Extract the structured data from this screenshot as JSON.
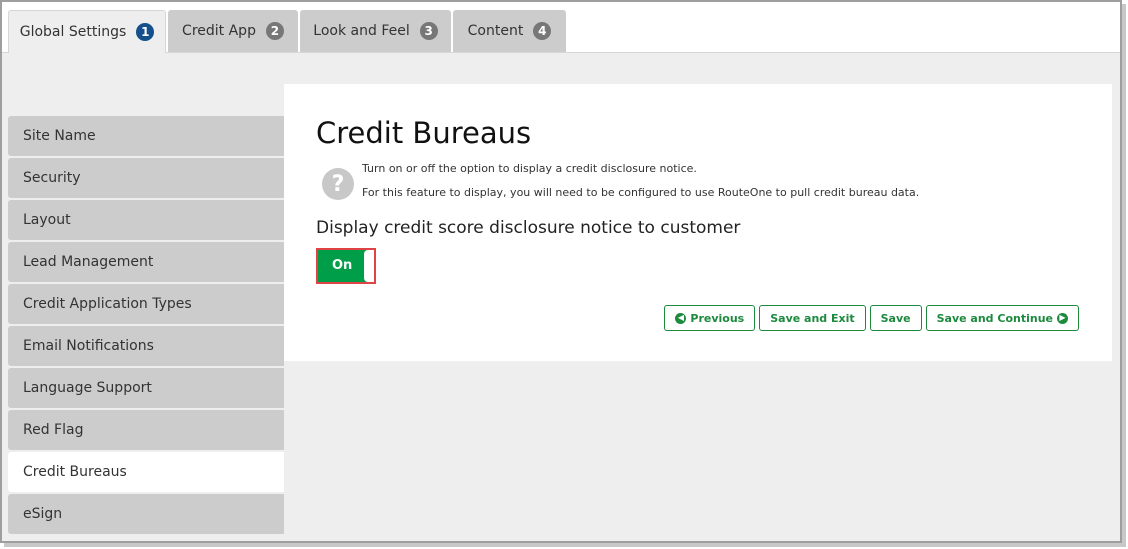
{
  "tabs": [
    {
      "label": "Global Settings",
      "badge": "1",
      "active": true
    },
    {
      "label": "Credit App",
      "badge": "2",
      "active": false
    },
    {
      "label": "Look and Feel",
      "badge": "3",
      "active": false
    },
    {
      "label": "Content",
      "badge": "4",
      "active": false
    }
  ],
  "sidebar": {
    "items": [
      {
        "label": "Site Name"
      },
      {
        "label": "Security"
      },
      {
        "label": "Layout"
      },
      {
        "label": "Lead Management"
      },
      {
        "label": "Credit Application Types"
      },
      {
        "label": "Email Notifications"
      },
      {
        "label": "Language Support"
      },
      {
        "label": "Red Flag"
      },
      {
        "label": "Credit Bureaus",
        "active": true
      },
      {
        "label": "eSign"
      }
    ]
  },
  "main": {
    "title": "Credit Bureaus",
    "help_icon": "question-circle-icon",
    "help_lines": [
      "Turn on or off the option to display a credit disclosure notice.",
      "For this feature to display, you will need to be configured to use RouteOne to pull credit bureau data."
    ],
    "setting_label": "Display credit score disclosure notice to customer",
    "toggle": {
      "label": "On",
      "state": "on"
    },
    "buttons": {
      "previous": "Previous",
      "save_exit": "Save and Exit",
      "save": "Save",
      "save_continue": "Save and Continue"
    }
  },
  "colors": {
    "accent_green": "#1d8a3d",
    "toggle_green": "#009e49",
    "toggle_highlight": "#e04343",
    "active_badge": "#14508c"
  }
}
